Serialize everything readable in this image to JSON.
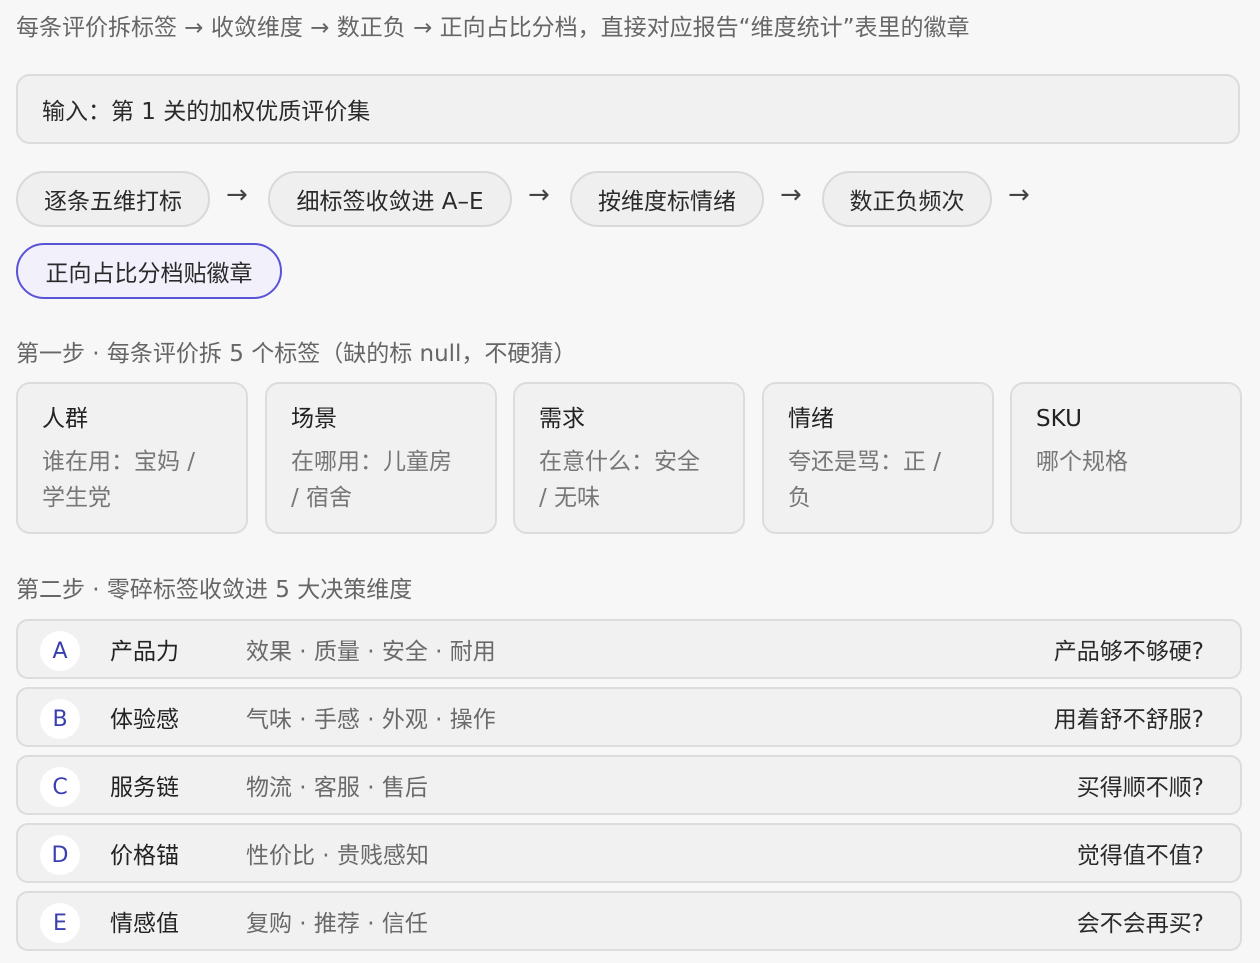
{
  "subtitle": "每条评价拆标签 → 收敛维度 → 数正负 → 正向占比分档，直接对应报告“维度统计”表里的徽章",
  "input_box": "输入：第 1 关的加权优质评价集",
  "flow": {
    "steps": [
      "逐条五维打标",
      "细标签收敛进 A–E",
      "按维度标情绪",
      "数正负频次",
      "正向占比分档贴徽章"
    ],
    "arrow": "→"
  },
  "step1": {
    "label": "第一步 · 每条评价拆 5 个标签（缺的标 null，不硬猜）",
    "cards": [
      {
        "title": "人群",
        "desc_lines": [
          "谁在用：宝妈 /",
          "学生党"
        ]
      },
      {
        "title": "场景",
        "desc_lines": [
          "在哪用：儿童房",
          "/ 宿舍"
        ]
      },
      {
        "title": "需求",
        "desc_lines": [
          "在意什么：安全",
          "/ 无味"
        ]
      },
      {
        "title": "情绪",
        "desc_lines": [
          "夸还是骂：正 /",
          "负"
        ]
      },
      {
        "title": "SKU",
        "desc_lines": [
          "哪个规格",
          ""
        ]
      }
    ]
  },
  "step2": {
    "label": "第二步 · 零碎标签收敛进 5 大决策维度",
    "dimensions": [
      {
        "letter": "A",
        "name": "产品力",
        "items": "效果 · 质量 · 安全 · 耐用",
        "question": "产品够不够硬?"
      },
      {
        "letter": "B",
        "name": "体验感",
        "items": "气味 · 手感 · 外观 · 操作",
        "question": "用着舒不舒服?"
      },
      {
        "letter": "C",
        "name": "服务链",
        "items": "物流 · 客服 · 售后",
        "question": "买得顺不顺?"
      },
      {
        "letter": "D",
        "name": "价格锚",
        "items": "性价比 · 贵贱感知",
        "question": "觉得值不值?"
      },
      {
        "letter": "E",
        "name": "情感值",
        "items": "复购 · 推荐 · 信任",
        "question": "会不会再买?"
      }
    ]
  },
  "colors": {
    "highlight_border": "#5b53d6",
    "letter_color": "#3a3fb0"
  }
}
